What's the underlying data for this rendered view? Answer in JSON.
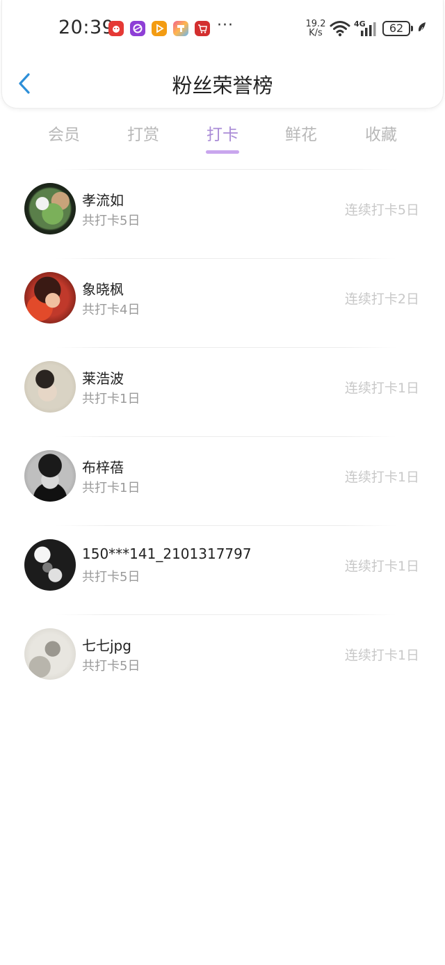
{
  "statusbar": {
    "time": "20:39",
    "more": "···",
    "net_speed_value": "19.2",
    "net_speed_unit": "K/s",
    "network_type": "4G",
    "battery": "62",
    "app_icons": [
      "red-mascot-app-icon",
      "purple-app-icon",
      "orange-play-app-icon",
      "colorful-app-icon",
      "red-cart-app-icon"
    ]
  },
  "nav": {
    "back_icon": "chevron-left-icon",
    "title": "粉丝荣誉榜"
  },
  "tabs": [
    {
      "label": "会员"
    },
    {
      "label": "打赏"
    },
    {
      "label": "打卡"
    },
    {
      "label": "鲜花"
    },
    {
      "label": "收藏"
    }
  ],
  "active_tab": "打卡",
  "colors": {
    "accent": "#a98bd6",
    "indicator": "#c9a6ee",
    "back_icon": "#2d8fd8"
  },
  "fans": [
    {
      "name": "孝流如",
      "total": "共打卡5日",
      "streak": "连续打卡5日"
    },
    {
      "name": "象晓枫",
      "total": "共打卡4日",
      "streak": "连续打卡2日"
    },
    {
      "name": "莱浩波",
      "total": "共打卡1日",
      "streak": "连续打卡1日"
    },
    {
      "name": "布梓蓓",
      "total": "共打卡1日",
      "streak": "连续打卡1日"
    },
    {
      "name": "150***141_2101317797",
      "total": "共打卡5日",
      "streak": "连续打卡1日"
    },
    {
      "name": "七七jpg",
      "total": "共打卡5日",
      "streak": "连续打卡1日"
    }
  ]
}
